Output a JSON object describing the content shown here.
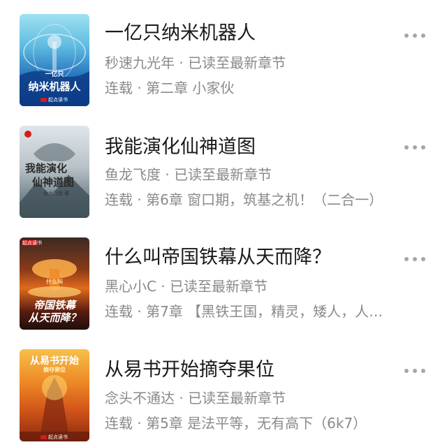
{
  "books": [
    {
      "title": "一亿只纳米机器人",
      "author_status": "秒速九光年 · 已读至最新章节",
      "progress": "连载 · 第二章 小家伙",
      "cover": {
        "small_text": "一亿只",
        "main_text": "纳米机器人",
        "publisher": "起点读书"
      }
    },
    {
      "title": "我能演化仙神道图",
      "author_status": "鱼龙飞度 · 已读至最新章节",
      "progress": "连载 · 第6章 窗口期，筑基之机！（二合一）",
      "cover": {
        "line1": "我能演化",
        "line2": "仙神道图",
        "author": "鱼龙飞度 著"
      }
    },
    {
      "title": "什么叫帝国铁幕从天而降？",
      "author_status": "黑心小C · 已读至最新章节",
      "progress": "连载 · 第7章 【黑铁王国，精灵，矮人，人…",
      "cover": {
        "small_text": "什么叫",
        "line1": "帝国铁幕",
        "line2": "从天而降？",
        "publisher": "起点读书"
      }
    },
    {
      "title": "从易书开始摘夺果位",
      "author_status": "念头不通达 · 已读至最新章节",
      "progress": "连载 · 第5章 是法平等，无有高下（6k7）",
      "cover": {
        "main_text": "从易书开始",
        "sub_text": "摘夺果位",
        "publisher": "起点读书"
      }
    }
  ],
  "more_icon": "ellipsis-icon",
  "colors": {
    "title": "#1a1a1a",
    "meta": "#8a8a8a",
    "more": "#a6a6a6",
    "brand_red": "#d41c1c"
  }
}
